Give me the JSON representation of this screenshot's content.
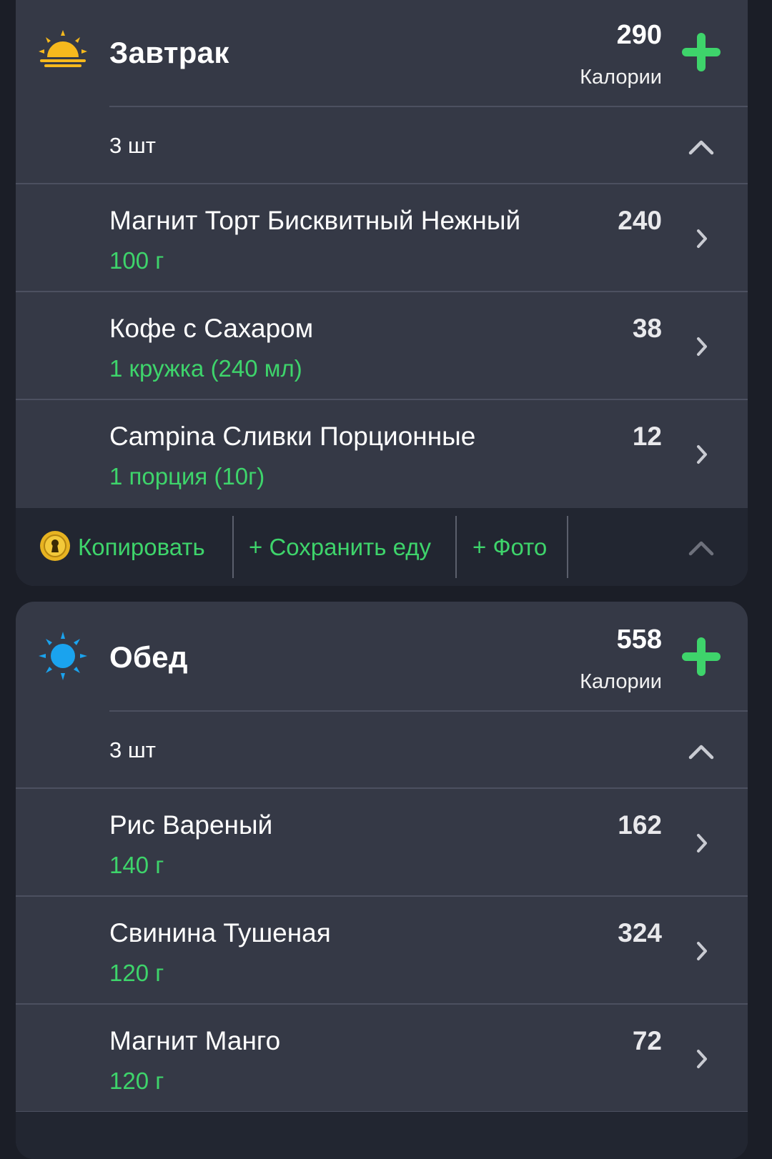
{
  "breakfast": {
    "title": "Завтрак",
    "icon": "sunrise-icon",
    "calories": "290",
    "calories_label": "Калории",
    "count": "3 шт",
    "items": [
      {
        "name": "Магнит Торт Бисквитный Нежный",
        "portion": "100 г",
        "calories": "240"
      },
      {
        "name": "Кофе с Сахаром",
        "portion": "1 кружка (240 мл)",
        "calories": "38"
      },
      {
        "name": "Campina Сливки Порционные",
        "portion": "1 порция (10г)",
        "calories": "12"
      }
    ],
    "actions": {
      "copy": "Копировать",
      "save_food": "+ Сохранить еду",
      "photo": "+ Фото"
    }
  },
  "lunch": {
    "title": "Обед",
    "icon": "sun-icon",
    "calories": "558",
    "calories_label": "Калории",
    "count": "3 шт",
    "items": [
      {
        "name": "Рис Вареный",
        "portion": "140 г",
        "calories": "162"
      },
      {
        "name": "Свинина Тушеная",
        "portion": "120 г",
        "calories": "324"
      },
      {
        "name": "Магнит Манго",
        "portion": "120 г",
        "calories": "72"
      }
    ]
  },
  "colors": {
    "accent_green": "#3ed46b",
    "card_bg": "#353946",
    "page_bg": "#1b1e27",
    "sunrise_yellow": "#f6b91d",
    "sun_blue": "#1aa3ee",
    "coin_gold": "#e7b321"
  }
}
